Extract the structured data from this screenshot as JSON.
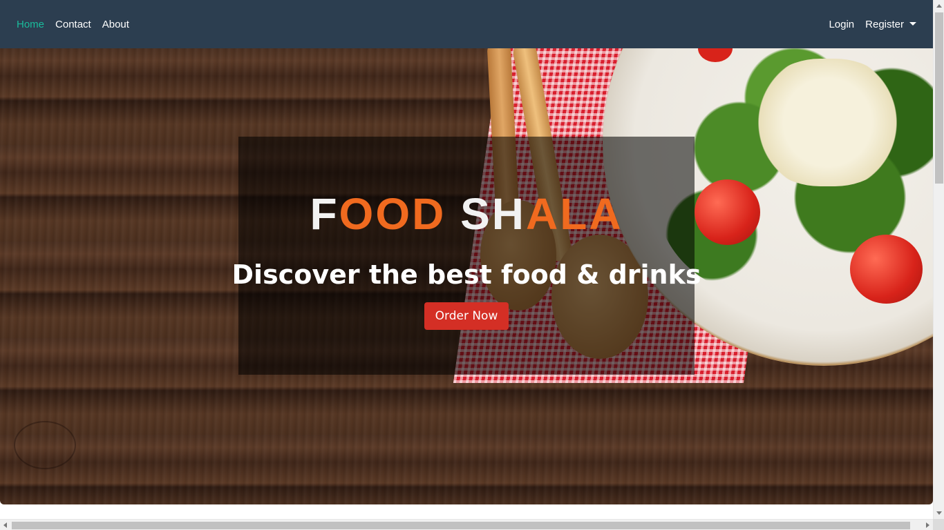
{
  "navbar": {
    "left_links": [
      {
        "label": "Home",
        "active": true
      },
      {
        "label": "Contact",
        "active": false
      },
      {
        "label": "About",
        "active": false
      }
    ],
    "right_links": {
      "login_label": "Login",
      "register_label": "Register"
    },
    "background_color": "#2c3e50",
    "active_color": "#1abc9c"
  },
  "hero": {
    "logo": {
      "word1": [
        "F",
        "OOD"
      ],
      "word2": [
        "SH",
        "ALA"
      ],
      "brand_orange": "#f06a1f"
    },
    "tagline": "Discover the best food & drinks",
    "cta_label": "Order Now",
    "cta_color": "#d42f25"
  }
}
